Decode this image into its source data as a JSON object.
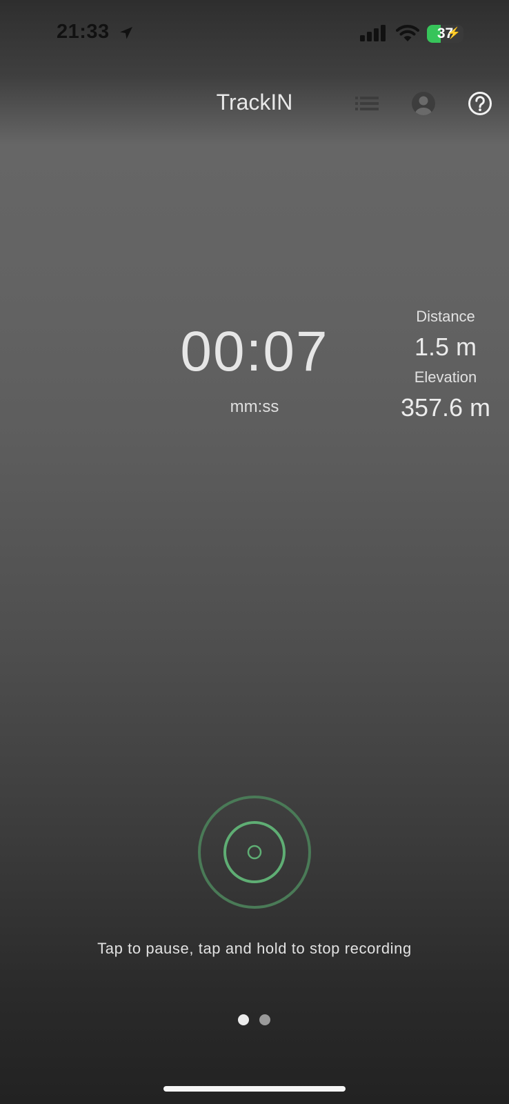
{
  "status_bar": {
    "time": "21:33",
    "battery_percent": "37",
    "battery_level": 0.37,
    "charging": true,
    "icons": [
      "location-arrow-icon",
      "cellular-signal-icon",
      "wifi-icon",
      "battery-icon"
    ]
  },
  "app_bar": {
    "title": "TrackIN",
    "icons": [
      "list-icon",
      "account-icon",
      "help-icon"
    ]
  },
  "timer": {
    "value": "00:07",
    "unit": "mm:ss"
  },
  "stats": {
    "distance_label": "Distance",
    "distance_value": "1.5 m",
    "elevation_label": "Elevation",
    "elevation_value": "357.6 m"
  },
  "record_button": {
    "icon": "record-icon",
    "color": "#5fae74"
  },
  "hint": "Tap to pause, tap and hold to stop recording",
  "pager": {
    "pages": 2,
    "active_page": 1
  },
  "colors": {
    "accent": "#5fae74",
    "battery": "#37c45a"
  }
}
